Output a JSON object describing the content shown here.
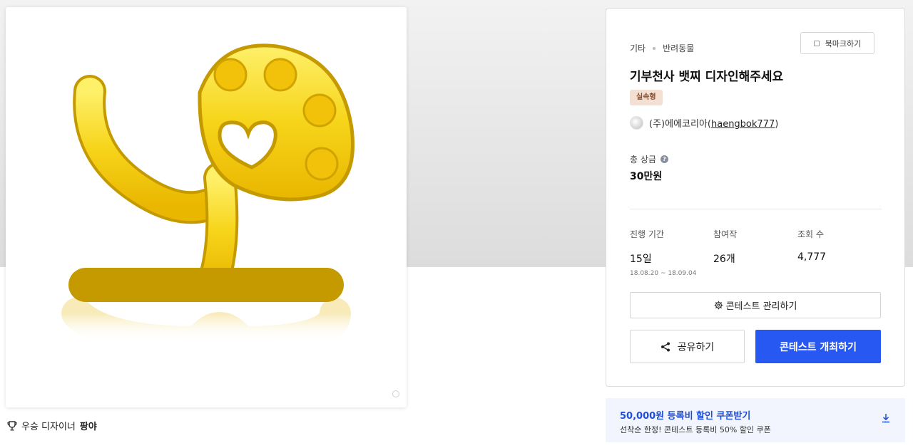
{
  "artwork": {
    "winner_label": "우승 디자이너",
    "winner_name": "팡야"
  },
  "panel": {
    "breadcrumb": [
      "기타",
      "반려동물"
    ],
    "bookmark_label": "북마크하기",
    "title": "기부천사 뱃찌 디자인해주세요",
    "badge": "실속형",
    "host_name": "(주)에에코리아",
    "host_id": "haengbok777",
    "prize_label": "총 상금",
    "prize_value": "30만원",
    "stats": [
      {
        "label": "진행 기간",
        "value": "15일",
        "sub": "18.08.20 ~ 18.09.04"
      },
      {
        "label": "참여작",
        "value": "26개"
      },
      {
        "label": "조회 수",
        "value": "4,777"
      }
    ],
    "manage_label": "콘테스트 관리하기",
    "share_label": "공유하기",
    "host_contest_label": "콘테스트 개최하기"
  },
  "coupon": {
    "title": "50,000원 등록비 할인 쿠폰받기",
    "subtitle": "선착순 한정! 콘테스트 등록비 50% 할인 쿠폰"
  },
  "colors": {
    "accent": "#2758f2",
    "badge_bg": "#f4e0d2",
    "gold": "#f2d21a"
  },
  "icons": [
    "trophy-icon",
    "bookmark-icon",
    "help-icon",
    "gear-icon",
    "share-icon",
    "download-icon"
  ]
}
